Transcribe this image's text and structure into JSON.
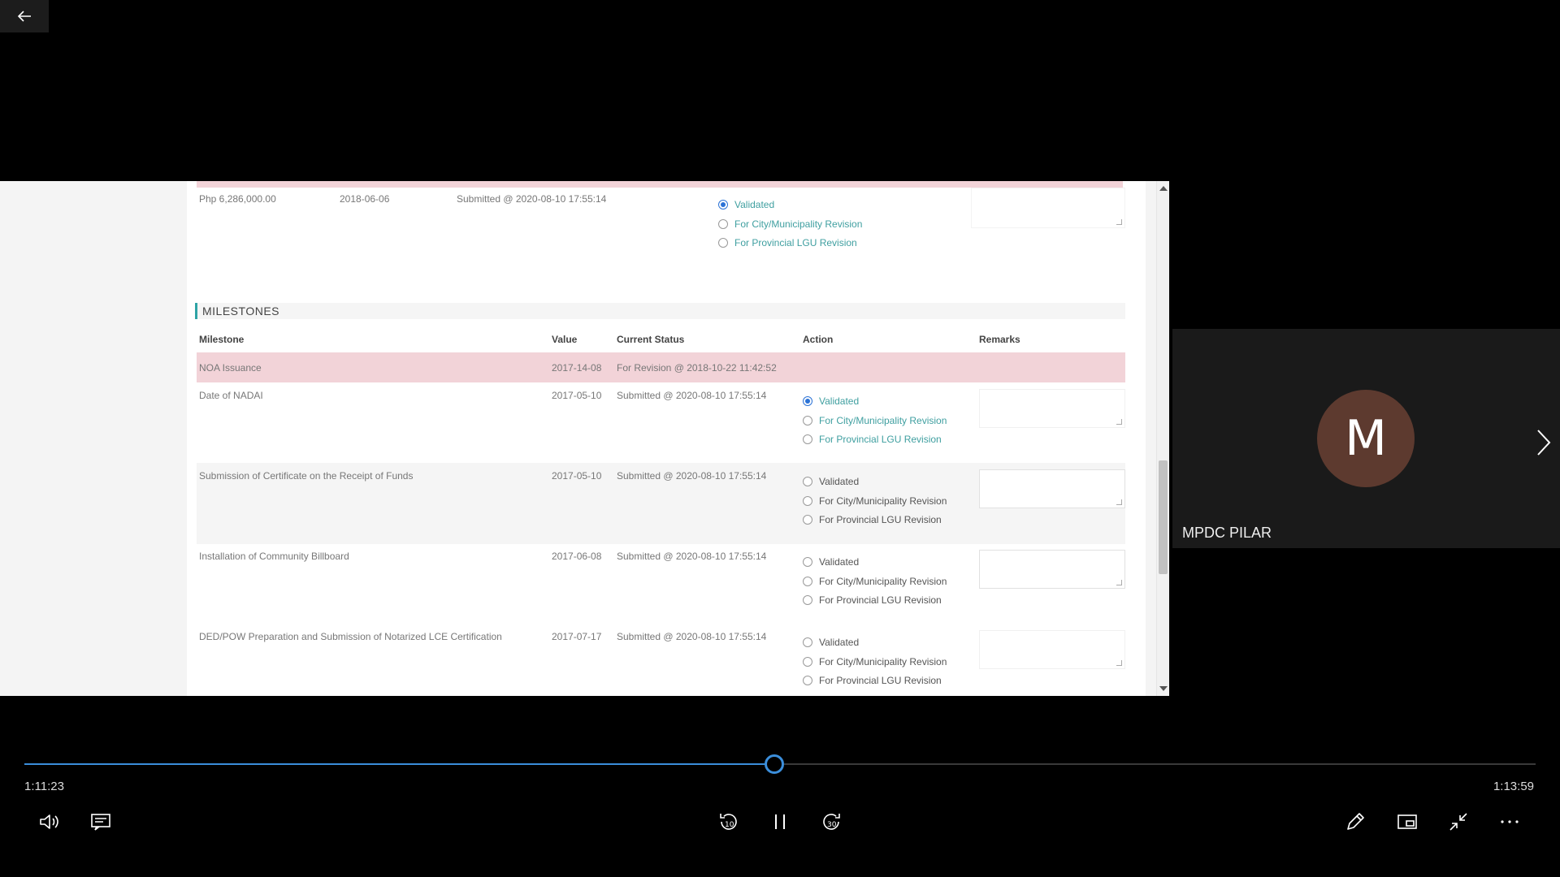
{
  "player": {
    "current_time": "1:11:23",
    "total_time": "1:13:59",
    "progress_fraction": 0.4965,
    "accent": "#3b8edb"
  },
  "participant": {
    "initial": "M",
    "name": "MPDC PILAR",
    "avatar_color": "#5d3a2f"
  },
  "screen": {
    "top_row": {
      "amount": "Php 6,286,000.00",
      "date": "2018-06-06",
      "status": "Submitted @ 2020-08-10 17:55:14",
      "options": [
        "Validated",
        "For City/Municipality Revision",
        "For Provincial LGU Revision"
      ]
    },
    "milestones": {
      "title": "MILESTONES",
      "headers": {
        "milestone": "Milestone",
        "value": "Value",
        "current_status": "Current Status",
        "action": "Action",
        "remarks": "Remarks"
      },
      "rows": [
        {
          "name": "NOA Issuance",
          "value": "2017-14-08",
          "status": "For Revision @ 2018-10-22 11:42:52"
        },
        {
          "name": "Date of NADAI",
          "value": "2017-05-10",
          "status": "Submitted @ 2020-08-10 17:55:14"
        },
        {
          "name": "Submission of Certificate on the Receipt of Funds",
          "value": "2017-05-10",
          "status": "Submitted @ 2020-08-10 17:55:14"
        },
        {
          "name": "Installation of Community Billboard",
          "value": "2017-06-08",
          "status": "Submitted @ 2020-08-10 17:55:14"
        },
        {
          "name": "DED/POW Preparation and Submission of Notarized LCE Certification",
          "value": "2017-07-17",
          "status": "Submitted @ 2020-08-10 17:55:14"
        }
      ],
      "action_options": [
        "Validated",
        "For City/Municipality Revision",
        "For Provincial LGU Revision"
      ]
    }
  }
}
